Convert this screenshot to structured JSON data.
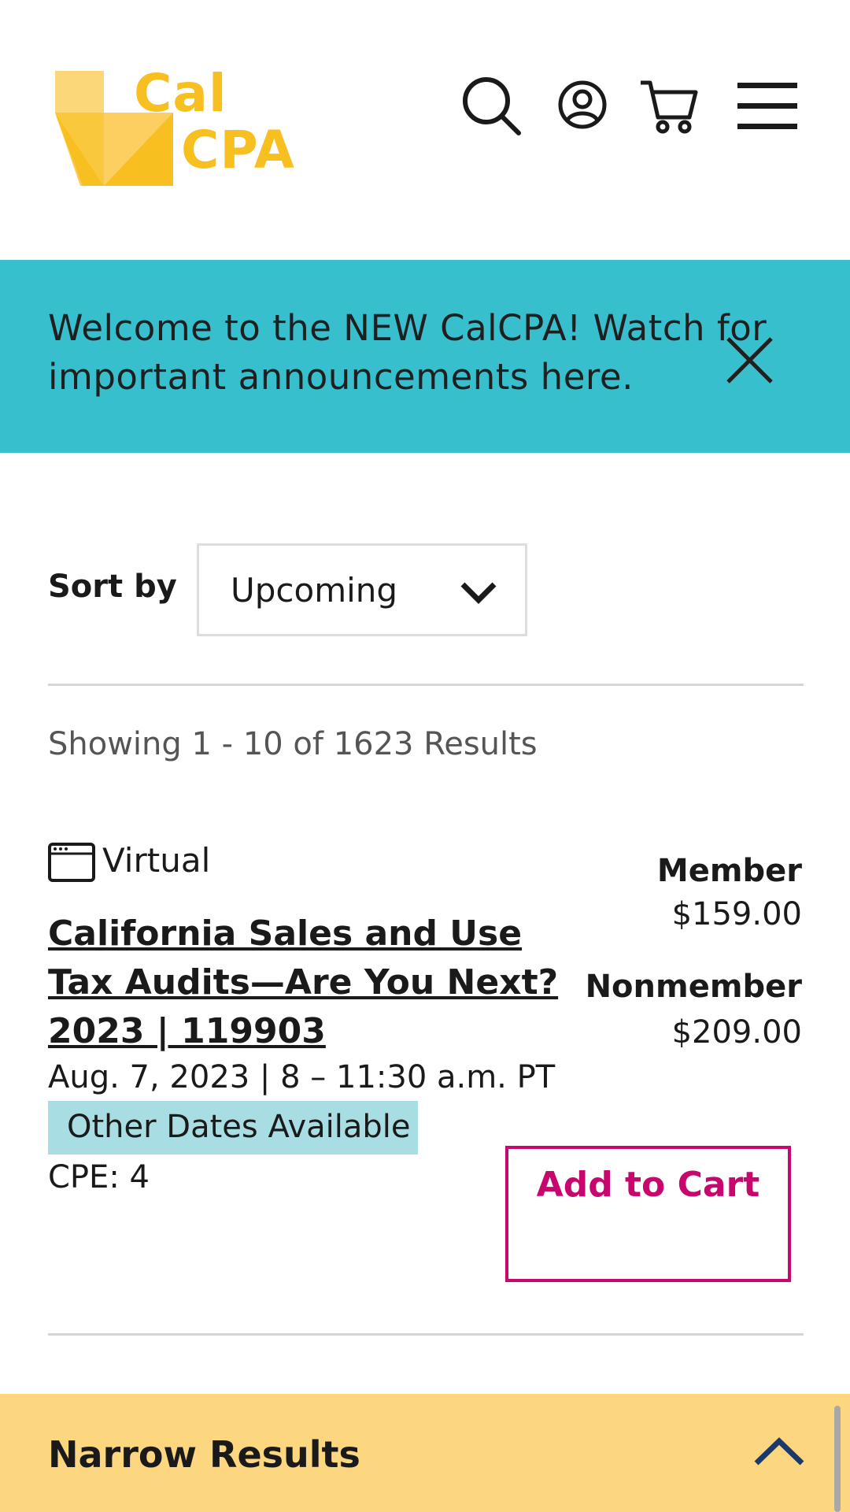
{
  "header": {
    "logo": {
      "line1": "Cal",
      "line2": "CPA"
    },
    "icons": [
      "search-icon",
      "account-icon",
      "cart-icon",
      "menu-icon"
    ]
  },
  "banner": {
    "text": "Welcome to the NEW CalCPA! Watch for important announcements here.",
    "close_icon": "close-icon"
  },
  "sort": {
    "label": "Sort by",
    "selected": "Upcoming"
  },
  "results": {
    "count_text": "Showing 1 - 10 of 1623 Results"
  },
  "course": {
    "format": "Virtual",
    "title": "California Sales and Use Tax Audits—Are You Next? 2023 | 119903",
    "date": "Aug. 7, 2023 | 8 – 11:30 a.m. PT",
    "other_dates": "Other Dates Available",
    "cpe": "CPE: 4",
    "member_label": "Member",
    "member_price": "$159.00",
    "nonmember_label": "Nonmember",
    "nonmember_price": "$209.00",
    "add_to_cart": "Add to Cart"
  },
  "narrow": {
    "title": "Narrow Results"
  },
  "colors": {
    "brand_yellow": "#f7bf1f",
    "banner_bg": "#38bfce",
    "badge_bg": "#a8dde3",
    "cart_magenta": "#c8076e",
    "narrow_bg": "#fdd680",
    "chevron_navy": "#1b3a6b"
  }
}
